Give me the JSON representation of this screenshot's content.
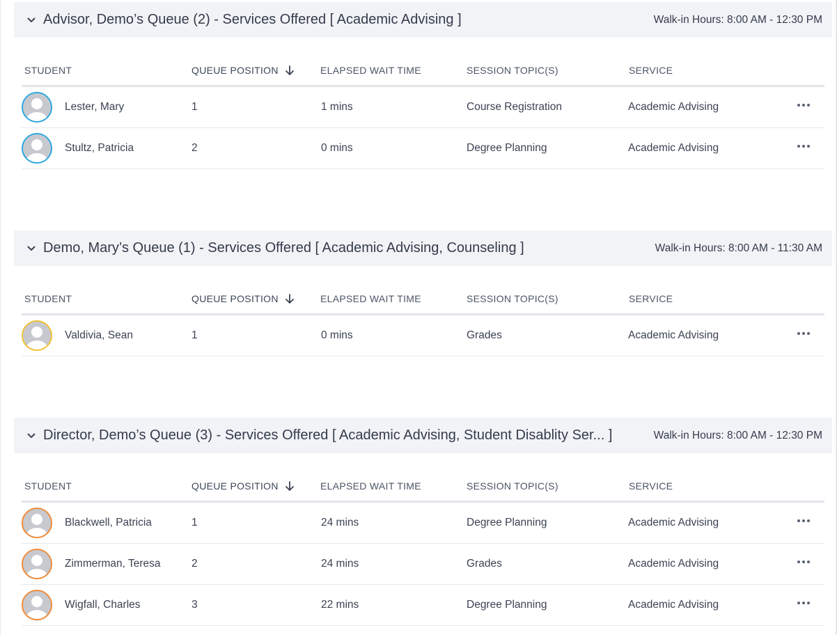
{
  "queues": [
    {
      "title": "Advisor, Demo’s Queue (2) - Services Offered [ Academic Advising ]",
      "walkin": "Walk-in Hours: 8:00 AM - 12:30 PM",
      "ring_color": "#29a7df",
      "columns": {
        "student": "STUDENT",
        "queue_position": "QUEUE POSITION",
        "elapsed_wait_time": "ELAPSED WAIT TIME",
        "session_topics": "SESSION TOPIC(S)",
        "service": "SERVICE"
      },
      "rows": [
        {
          "name": "Lester, Mary",
          "position": "1",
          "wait": "1 mins",
          "topic": "Course Registration",
          "service": "Academic Advising"
        },
        {
          "name": "Stultz, Patricia",
          "position": "2",
          "wait": "0 mins",
          "topic": "Degree Planning",
          "service": "Academic Advising"
        }
      ]
    },
    {
      "title": "Demo, Mary’s Queue (1) - Services Offered [ Academic Advising, Counseling ]",
      "walkin": "Walk-in Hours: 8:00 AM - 11:30 AM",
      "ring_color": "#f2c230",
      "columns": {
        "student": "STUDENT",
        "queue_position": "QUEUE POSITION",
        "elapsed_wait_time": "ELAPSED WAIT TIME",
        "session_topics": "SESSION TOPIC(S)",
        "service": "SERVICE"
      },
      "rows": [
        {
          "name": "Valdivia, Sean",
          "position": "1",
          "wait": "0 mins",
          "topic": "Grades",
          "service": "Academic Advising"
        }
      ]
    },
    {
      "title": "Director, Demo’s Queue (3) - Services Offered [ Academic Advising, Student Disablity Ser... ]",
      "walkin": "Walk-in Hours: 8:00 AM - 12:30 PM",
      "ring_color": "#f08a36",
      "columns": {
        "student": "STUDENT",
        "queue_position": "QUEUE POSITION",
        "elapsed_wait_time": "ELAPSED WAIT TIME",
        "session_topics": "SESSION TOPIC(S)",
        "service": "SERVICE"
      },
      "rows": [
        {
          "name": "Blackwell, Patricia",
          "position": "1",
          "wait": "24 mins",
          "topic": "Degree Planning",
          "service": "Academic Advising"
        },
        {
          "name": "Zimmerman, Teresa",
          "position": "2",
          "wait": "24 mins",
          "topic": "Grades",
          "service": "Academic Advising"
        },
        {
          "name": "Wigfall, Charles",
          "position": "3",
          "wait": "22 mins",
          "topic": "Degree Planning",
          "service": "Academic Advising"
        }
      ]
    }
  ]
}
